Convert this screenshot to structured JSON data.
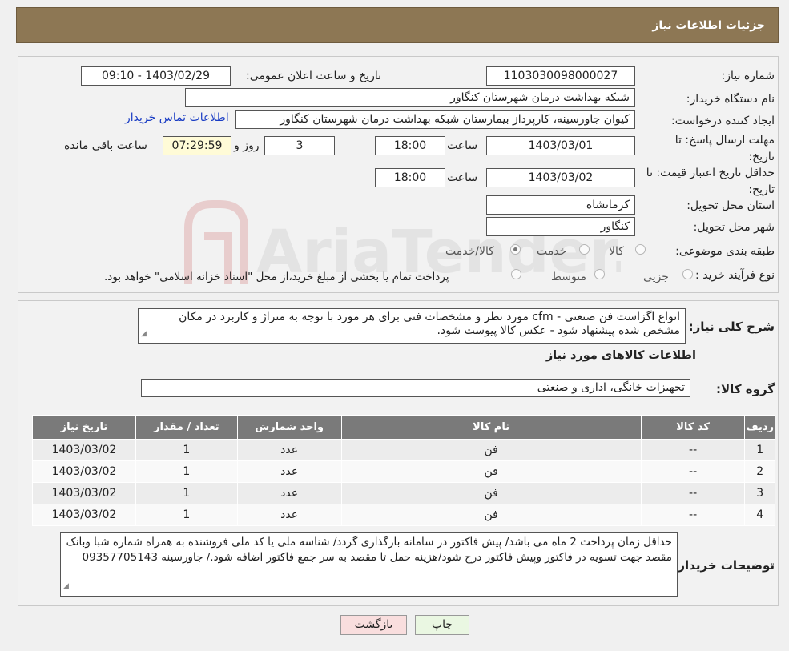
{
  "header": {
    "title": "جزئیات اطلاعات نیاز"
  },
  "form": {
    "need_number_label": "شماره نیاز:",
    "need_number": "1103030098000027",
    "announce_label": "تاریخ و ساعت اعلان عمومی:",
    "announce_value": "1403/02/29 - 09:10",
    "buyer_org_label": "نام دستگاه خریدار:",
    "buyer_org": "شبکه بهداشت درمان شهرستان کنگاور",
    "requester_label": "ایجاد کننده درخواست:",
    "requester": "کیوان جاورسینه، کارپرداز بیمارستان شبکه بهداشت درمان شهرستان کنگاور",
    "contact_link": "اطلاعات تماس خریدار",
    "deadline_label": "مهلت ارسال پاسخ: تا تاریخ:",
    "deadline_date": "1403/03/01",
    "time_label": "ساعت",
    "deadline_time": "18:00",
    "days_value": "3",
    "days_label": "روز و",
    "remaining_time": "07:29:59",
    "remaining_label": "ساعت باقی مانده",
    "validity_label": "حداقل تاریخ اعتبار قیمت: تا تاریخ:",
    "validity_date": "1403/03/02",
    "validity_time": "18:00",
    "province_label": "استان محل تحویل:",
    "province": "کرمانشاه",
    "city_label": "شهر محل تحویل:",
    "city": "کنگاور",
    "category_label": "طبقه بندی موضوعی:",
    "category_options": [
      "کالا",
      "خدمت",
      "کالا/خدمت"
    ],
    "process_label": "نوع فرآیند خرید :",
    "process_options": [
      "جزیی",
      "متوسط"
    ],
    "process_note": "پرداخت تمام یا بخشی از مبلغ خرید،از محل \"اسناد خزانه اسلامی\" خواهد بود."
  },
  "details": {
    "summary_label": "شرح کلی نیاز:",
    "summary_text": "انواع اگزاست فن صنعتی - cfm مورد نظر و مشخصات فنی برای هر مورد با توجه به متراژ و کاربرد در مکان مشخص شده پیشنهاد شود - عکس کالا پیوست شود.",
    "goods_info_title": "اطلاعات کالاهای مورد نیاز",
    "goods_group_label": "گروه کالا:",
    "goods_group": "تجهیزات خانگی، اداری و صنعتی"
  },
  "table": {
    "headers": [
      "ردیف",
      "کد کالا",
      "نام کالا",
      "واحد شمارش",
      "تعداد / مقدار",
      "تاریخ نیاز"
    ],
    "rows": [
      [
        "1",
        "--",
        "فن",
        "عدد",
        "1",
        "1403/03/02"
      ],
      [
        "2",
        "--",
        "فن",
        "عدد",
        "1",
        "1403/03/02"
      ],
      [
        "3",
        "--",
        "فن",
        "عدد",
        "1",
        "1403/03/02"
      ],
      [
        "4",
        "--",
        "فن",
        "عدد",
        "1",
        "1403/03/02"
      ]
    ]
  },
  "buyer_notes": {
    "label": "توضیحات خریدار:",
    "text": "حداقل زمان پرداخت 2 ماه می باشد/ پیش فاکتور در سامانه بارگذاری گردد/ شناسه ملی یا کد ملی فروشنده به همراه شماره شبا وبانک مقصد جهت تسویه در فاکتور وپیش فاکتور درج شود/هزینه حمل تا مقصد به سر جمع فاکتور اضافه شود./ جاورسینه 09357705143"
  },
  "buttons": {
    "print": "چاپ",
    "back": "بازگشت"
  },
  "watermark": {
    "text": "AriaTender.neT"
  }
}
